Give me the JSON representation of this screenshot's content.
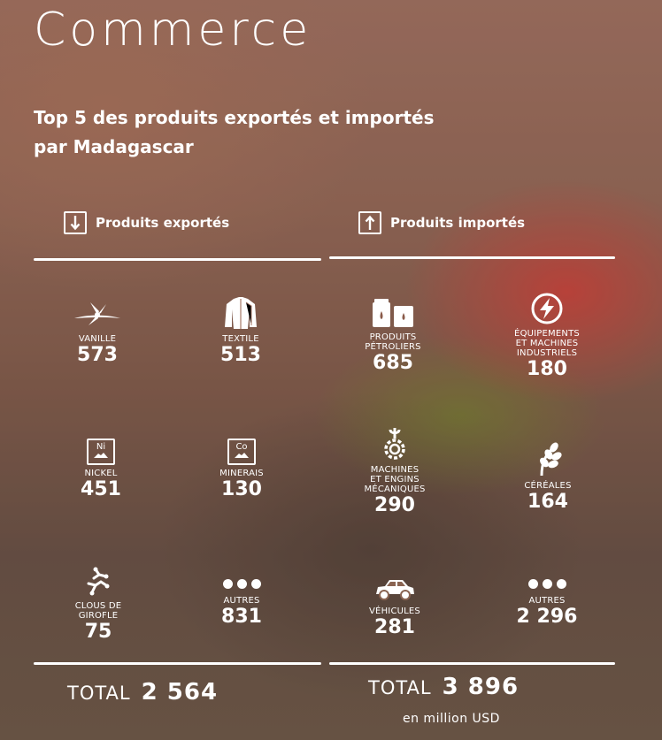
{
  "title": "Commerce",
  "subtitle_lines": [
    "Top 5 des produits exportés et importés",
    "par Madagascar"
  ],
  "exports": {
    "header": "Produits exportés",
    "items": [
      {
        "label": [
          "VANILLE"
        ],
        "value": "573",
        "icon": "vanilla-icon"
      },
      {
        "label": [
          "TEXTILE"
        ],
        "value": "513",
        "icon": "textile-icon"
      },
      {
        "label": [
          "NICKEL"
        ],
        "value": "451",
        "icon": "nickel-icon",
        "symbol": "Ni"
      },
      {
        "label": [
          "MINERAIS"
        ],
        "value": "130",
        "icon": "minerals-icon",
        "symbol": "Co"
      },
      {
        "label": [
          "CLOUS DE",
          "GIROFLE"
        ],
        "value": "75",
        "icon": "clove-icon"
      },
      {
        "label": [
          "AUTRES"
        ],
        "value": "831",
        "icon": "dots-icon"
      }
    ],
    "total_label": "TOTAL",
    "total_value": "2 564"
  },
  "imports": {
    "header": "Produits importés",
    "items": [
      {
        "label": [
          "PRODUITS",
          "PÉTROLIERS"
        ],
        "value": "685",
        "icon": "oil-barrels-icon"
      },
      {
        "label": [
          "ÉQUIPEMENTS",
          "ET MACHINES",
          "INDUSTRIELS"
        ],
        "value": "180",
        "icon": "lightning-icon"
      },
      {
        "label": [
          "MACHINES",
          "ET ENGINS",
          "MÉCANIQUES"
        ],
        "value": "290",
        "icon": "gear-wrench-icon"
      },
      {
        "label": [
          "CÉRÉALES"
        ],
        "value": "164",
        "icon": "grain-icon"
      },
      {
        "label": [
          "VÉHICULES"
        ],
        "value": "281",
        "icon": "car-icon"
      },
      {
        "label": [
          "AUTRES"
        ],
        "value": "2 296",
        "icon": "dots-icon"
      }
    ],
    "total_label": "TOTAL",
    "total_value": "3 896",
    "unit": "en million USD"
  }
}
